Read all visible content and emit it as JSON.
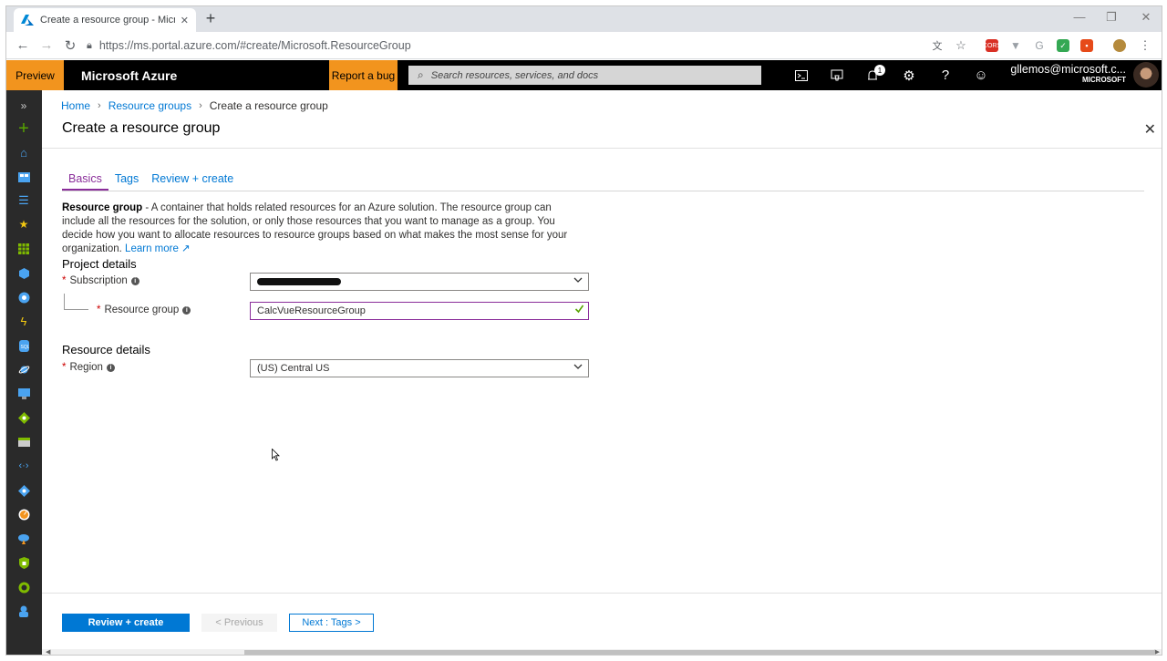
{
  "browser": {
    "tab_title": "Create a resource group - Micros",
    "tab_close": "✕",
    "new_tab": "+",
    "url": "https://ms.portal.azure.com/#create/Microsoft.ResourceGroup",
    "minimize": "—",
    "restore": "❐",
    "close": "✕",
    "extensions": [
      "translate-icon",
      "star-icon",
      "cors-extension-icon",
      "v-extension-icon",
      "google-extension-icon",
      "green-extension-icon",
      "office-extension-icon",
      "profile-icon",
      "menu-icon"
    ],
    "cors_label": "CORS"
  },
  "azure": {
    "preview_label": "Preview",
    "brand": "Microsoft Azure",
    "report_bug": "Report a bug",
    "search_placeholder": "Search resources, services, and docs",
    "notification_count": "1",
    "account_email": "gllemos@microsoft.c...",
    "account_tenant": "MICROSOFT",
    "accent_color": "#f2941e"
  },
  "breadcrumb": {
    "home": "Home",
    "resource_groups": "Resource groups",
    "current": "Create a resource group"
  },
  "blade": {
    "title": "Create a resource group",
    "close": "✕"
  },
  "tabs": {
    "basics": "Basics",
    "tags": "Tags",
    "review": "Review + create"
  },
  "description": {
    "lead": "Resource group",
    "text": " - A container that holds related resources for an Azure solution. The resource group can include all the resources for the solution, or only those resources that you want to manage as a group. You decide how you want to allocate resources to resource groups based on what makes the most sense for your organization. ",
    "learn_more": "Learn more"
  },
  "project_details": {
    "heading": "Project details",
    "subscription_label": "Subscription",
    "resource_group_label": "Resource group",
    "resource_group_value": "CalcVueResourceGroup"
  },
  "resource_details": {
    "heading": "Resource details",
    "region_label": "Region",
    "region_value": "(US) Central US"
  },
  "footer": {
    "review_create": "Review + create",
    "previous": "< Previous",
    "next": "Next : Tags >"
  }
}
